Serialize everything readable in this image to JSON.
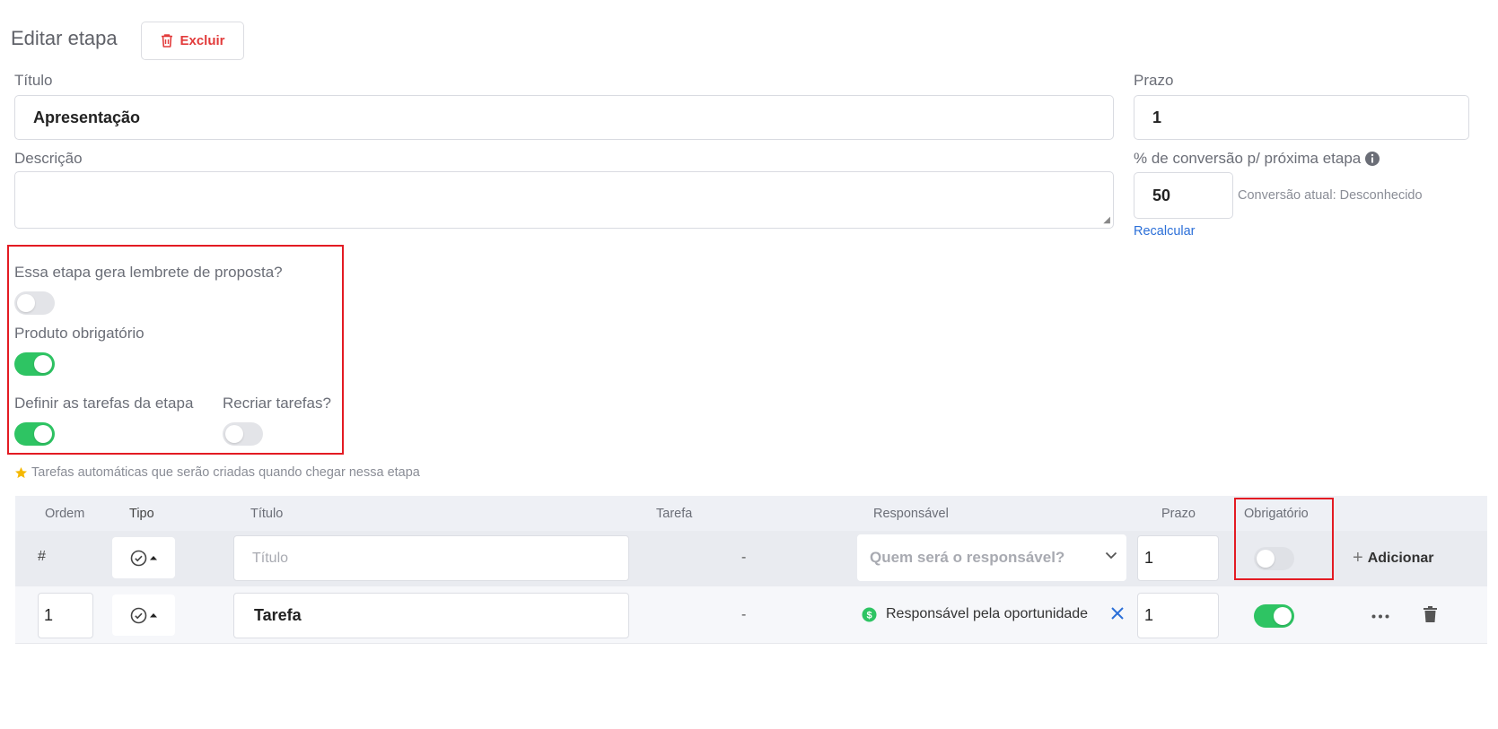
{
  "header": {
    "title": "Editar etapa",
    "delete_label": "Excluir"
  },
  "form": {
    "titulo_label": "Título",
    "titulo_value": "Apresentação",
    "prazo_label": "Prazo",
    "prazo_value": "1",
    "descricao_label": "Descrição",
    "descricao_value": "",
    "conversao_label": "% de conversão p/ próxima etapa",
    "conversao_value": "50",
    "conversao_atual": "Conversão atual: Desconhecido",
    "recalcular_label": "Recalcular"
  },
  "toggles": {
    "lembrete": {
      "label": "Essa etapa gera lembrete de proposta?",
      "on": false
    },
    "produto": {
      "label": "Produto obrigatório",
      "on": true
    },
    "tarefas": {
      "label": "Definir as tarefas da etapa",
      "on": true
    },
    "recriar": {
      "label": "Recriar tarefas?",
      "on": false
    }
  },
  "hint": "Tarefas automáticas que serão criadas quando chegar nessa etapa",
  "table": {
    "headers": {
      "ordem": "Ordem",
      "tipo": "Tipo",
      "titulo": "Título",
      "tarefa": "Tarefa",
      "responsavel": "Responsável",
      "prazo": "Prazo",
      "obrigatorio": "Obrigatório"
    },
    "new_row": {
      "ordem": "#",
      "titulo_placeholder": "Título",
      "tarefa": "-",
      "responsavel_placeholder": "Quem será o responsável?",
      "prazo": "1",
      "obrigatorio": false,
      "add_label": "Adicionar"
    },
    "rows": [
      {
        "ordem": "1",
        "titulo": "Tarefa",
        "tarefa": "-",
        "responsavel": "Responsável pela oportunidade",
        "prazo": "1",
        "obrigatorio": true
      }
    ]
  },
  "colors": {
    "accent_green": "#2ec463",
    "danger_red": "#e23b3b",
    "highlight_red": "#e31b23",
    "link_blue": "#2b6fd8",
    "star_yellow": "#f5b800"
  }
}
